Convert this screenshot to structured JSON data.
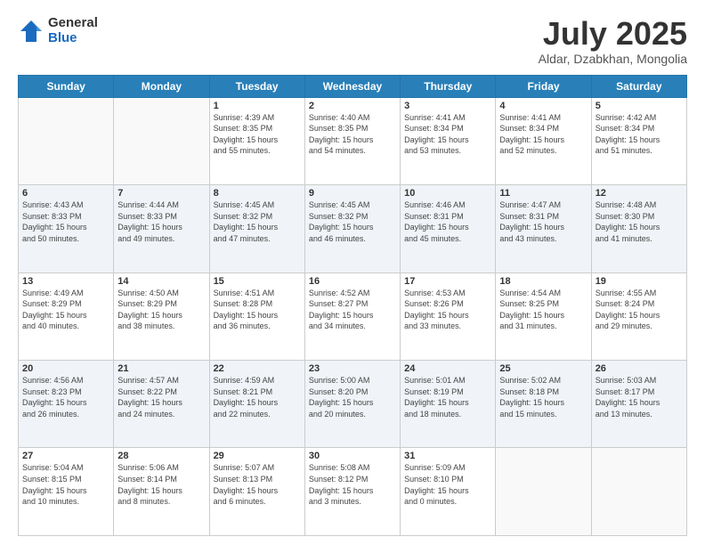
{
  "logo": {
    "general": "General",
    "blue": "Blue"
  },
  "header": {
    "month": "July 2025",
    "location": "Aldar, Dzabkhan, Mongolia"
  },
  "weekdays": [
    "Sunday",
    "Monday",
    "Tuesday",
    "Wednesday",
    "Thursday",
    "Friday",
    "Saturday"
  ],
  "weeks": [
    [
      {
        "day": "",
        "info": ""
      },
      {
        "day": "",
        "info": ""
      },
      {
        "day": "1",
        "info": "Sunrise: 4:39 AM\nSunset: 8:35 PM\nDaylight: 15 hours\nand 55 minutes."
      },
      {
        "day": "2",
        "info": "Sunrise: 4:40 AM\nSunset: 8:35 PM\nDaylight: 15 hours\nand 54 minutes."
      },
      {
        "day": "3",
        "info": "Sunrise: 4:41 AM\nSunset: 8:34 PM\nDaylight: 15 hours\nand 53 minutes."
      },
      {
        "day": "4",
        "info": "Sunrise: 4:41 AM\nSunset: 8:34 PM\nDaylight: 15 hours\nand 52 minutes."
      },
      {
        "day": "5",
        "info": "Sunrise: 4:42 AM\nSunset: 8:34 PM\nDaylight: 15 hours\nand 51 minutes."
      }
    ],
    [
      {
        "day": "6",
        "info": "Sunrise: 4:43 AM\nSunset: 8:33 PM\nDaylight: 15 hours\nand 50 minutes."
      },
      {
        "day": "7",
        "info": "Sunrise: 4:44 AM\nSunset: 8:33 PM\nDaylight: 15 hours\nand 49 minutes."
      },
      {
        "day": "8",
        "info": "Sunrise: 4:45 AM\nSunset: 8:32 PM\nDaylight: 15 hours\nand 47 minutes."
      },
      {
        "day": "9",
        "info": "Sunrise: 4:45 AM\nSunset: 8:32 PM\nDaylight: 15 hours\nand 46 minutes."
      },
      {
        "day": "10",
        "info": "Sunrise: 4:46 AM\nSunset: 8:31 PM\nDaylight: 15 hours\nand 45 minutes."
      },
      {
        "day": "11",
        "info": "Sunrise: 4:47 AM\nSunset: 8:31 PM\nDaylight: 15 hours\nand 43 minutes."
      },
      {
        "day": "12",
        "info": "Sunrise: 4:48 AM\nSunset: 8:30 PM\nDaylight: 15 hours\nand 41 minutes."
      }
    ],
    [
      {
        "day": "13",
        "info": "Sunrise: 4:49 AM\nSunset: 8:29 PM\nDaylight: 15 hours\nand 40 minutes."
      },
      {
        "day": "14",
        "info": "Sunrise: 4:50 AM\nSunset: 8:29 PM\nDaylight: 15 hours\nand 38 minutes."
      },
      {
        "day": "15",
        "info": "Sunrise: 4:51 AM\nSunset: 8:28 PM\nDaylight: 15 hours\nand 36 minutes."
      },
      {
        "day": "16",
        "info": "Sunrise: 4:52 AM\nSunset: 8:27 PM\nDaylight: 15 hours\nand 34 minutes."
      },
      {
        "day": "17",
        "info": "Sunrise: 4:53 AM\nSunset: 8:26 PM\nDaylight: 15 hours\nand 33 minutes."
      },
      {
        "day": "18",
        "info": "Sunrise: 4:54 AM\nSunset: 8:25 PM\nDaylight: 15 hours\nand 31 minutes."
      },
      {
        "day": "19",
        "info": "Sunrise: 4:55 AM\nSunset: 8:24 PM\nDaylight: 15 hours\nand 29 minutes."
      }
    ],
    [
      {
        "day": "20",
        "info": "Sunrise: 4:56 AM\nSunset: 8:23 PM\nDaylight: 15 hours\nand 26 minutes."
      },
      {
        "day": "21",
        "info": "Sunrise: 4:57 AM\nSunset: 8:22 PM\nDaylight: 15 hours\nand 24 minutes."
      },
      {
        "day": "22",
        "info": "Sunrise: 4:59 AM\nSunset: 8:21 PM\nDaylight: 15 hours\nand 22 minutes."
      },
      {
        "day": "23",
        "info": "Sunrise: 5:00 AM\nSunset: 8:20 PM\nDaylight: 15 hours\nand 20 minutes."
      },
      {
        "day": "24",
        "info": "Sunrise: 5:01 AM\nSunset: 8:19 PM\nDaylight: 15 hours\nand 18 minutes."
      },
      {
        "day": "25",
        "info": "Sunrise: 5:02 AM\nSunset: 8:18 PM\nDaylight: 15 hours\nand 15 minutes."
      },
      {
        "day": "26",
        "info": "Sunrise: 5:03 AM\nSunset: 8:17 PM\nDaylight: 15 hours\nand 13 minutes."
      }
    ],
    [
      {
        "day": "27",
        "info": "Sunrise: 5:04 AM\nSunset: 8:15 PM\nDaylight: 15 hours\nand 10 minutes."
      },
      {
        "day": "28",
        "info": "Sunrise: 5:06 AM\nSunset: 8:14 PM\nDaylight: 15 hours\nand 8 minutes."
      },
      {
        "day": "29",
        "info": "Sunrise: 5:07 AM\nSunset: 8:13 PM\nDaylight: 15 hours\nand 6 minutes."
      },
      {
        "day": "30",
        "info": "Sunrise: 5:08 AM\nSunset: 8:12 PM\nDaylight: 15 hours\nand 3 minutes."
      },
      {
        "day": "31",
        "info": "Sunrise: 5:09 AM\nSunset: 8:10 PM\nDaylight: 15 hours\nand 0 minutes."
      },
      {
        "day": "",
        "info": ""
      },
      {
        "day": "",
        "info": ""
      }
    ]
  ]
}
